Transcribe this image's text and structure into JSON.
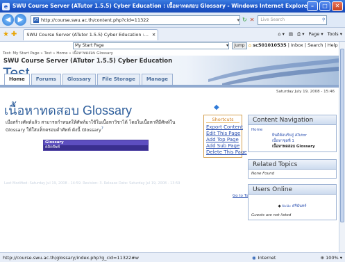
{
  "browser": {
    "window_title": "SWU Course Server (ATutor 1.5.5) Cyber Education : เนื้อหาทดสอบ Glossary - Windows Internet Explorer",
    "address": "http://course.swu.ac.th/content.php?cid=11322",
    "search_placeholder": "Live Search",
    "tab_title": "SWU Course Server (ATutor 1.5.5) Cyber Education :...",
    "page_menu": "Page",
    "tools_menu": "Tools",
    "status_url": "http://course.swu.ac.th/glossary/index.php?g_cid=11322#w",
    "status_zone": "Internet",
    "zoom": "100%"
  },
  "tutor": {
    "jump_select": "My Start Page",
    "jump_button": "Jump",
    "username": "sc501010535",
    "links": "| Inbox | Search | Help | Log-out",
    "breadcrumb": "Test: My Start Page » Test » Home » เนื้อหาทดสอบ Glossary"
  },
  "header": {
    "site_name": "SWU Course Server (ATutor 1.5.5) Cyber Education",
    "course_title": "Test"
  },
  "nav": {
    "tabs": [
      "Home",
      "Forums",
      "Glossary",
      "File Storage",
      "Manage"
    ]
  },
  "page": {
    "date": "Saturday July 19, 2008 - 15:46",
    "heading": "เนื้อหาทดสอบ Glossary",
    "description": "เมื่อสร้างศัพท์แล้ว สามารถกำหนดให้ศัพท์มาใช้ในเนื้อหาวิชาได้ โดยในเนื้อหาที่มีศัพท์ใน Glossary ให้ใส่แท็กครอบคำศัพท์ ดังนี้ Glossary",
    "description_sup": "?",
    "glossary_row1": "Glossary",
    "glossary_row2": "คลิกศัพท์",
    "footer_meta": "Last Modified: Saturday Jul 19, 2008 - 14:59. Revision: 3. Release Date: Saturday Jul 19, 2008 - 13:59",
    "go_to_top": "Go to Top"
  },
  "shortcuts": {
    "title": "Shortcuts",
    "items": [
      "Export Content",
      "Edit This Page",
      "Add Top Page",
      "Add Sub Page",
      "Delete This Page"
    ]
  },
  "sidebar": {
    "content_navigation": {
      "title": "Content Navigation",
      "items": [
        "Home",
        "ยินดีต้อนรับสู่ ATutor",
        "เนื้อหาชุดที่ 1",
        "เนื้อหาทดสอบ Glossary"
      ]
    },
    "related_topics": {
      "title": "Related Topics",
      "empty": "None Found"
    },
    "users_online": {
      "title": "Users Online",
      "user": "ยะมะ  ศรีนันทร์",
      "guests": "Guests are not listed"
    }
  }
}
